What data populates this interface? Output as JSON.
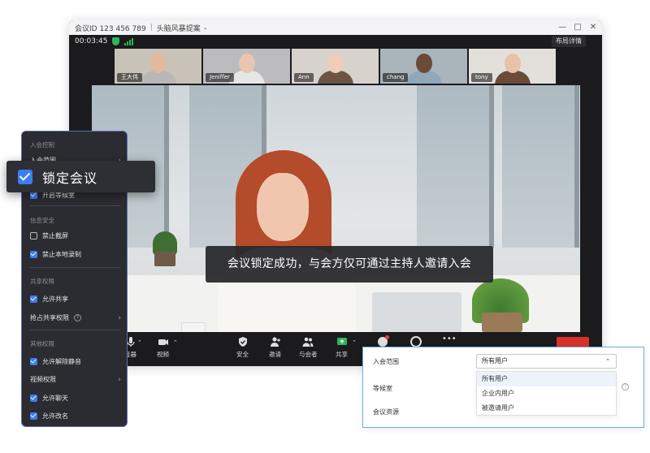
{
  "window": {
    "meeting_id": "会议ID 123 456 789",
    "meeting_topic": "头脑风暴提案",
    "timer": "00:03:45",
    "layout_button": "布局详情"
  },
  "participants": [
    {
      "name": "王大伟",
      "bg": "#c9c2b8",
      "skin": "#e2b99d",
      "clothes": "#b7b7b7"
    },
    {
      "name": "Jeniffer",
      "bg": "#bcbcbe",
      "skin": "#e9c6af",
      "clothes": "#e6e6e6"
    },
    {
      "name": "Ann",
      "bg": "#d7d2cc",
      "skin": "#f0cdb6",
      "clothes": "#6b5443"
    },
    {
      "name": "chang",
      "bg": "#a9b4bb",
      "skin": "#6b4a37",
      "clothes": "#8fa7b8"
    },
    {
      "name": "tony",
      "bg": "#e3e0dc",
      "skin": "#e8c2a4",
      "clothes": "#6b4a37"
    }
  ],
  "toast": "会议锁定成功，与会方仅可通过主持人邀请入会",
  "toolbar": {
    "audio": "音器",
    "video": "视频",
    "security": "安全",
    "invite": "邀请",
    "participants": "与会者",
    "share": "共享"
  },
  "security_panel": {
    "section_join": "入会控制",
    "join_range": "入会范围",
    "enable_waiting_room": "开启等候室",
    "section_info": "信息安全",
    "forbid_screenshot": "禁止截屏",
    "forbid_local_record": "禁止本地录制",
    "section_share": "共享权限",
    "allow_share": "允许共享",
    "preempt_share": "抢占共享权限",
    "section_other": "其他权限",
    "allow_unmute": "允许解除静音",
    "video_permission": "视频权限",
    "allow_chat": "允许聊天",
    "allow_rename": "允许改名",
    "lock_meeting": "锁定会议"
  },
  "checkbox_states": {
    "enable_waiting_room": true,
    "forbid_screenshot": false,
    "forbid_local_record": true,
    "allow_share": true,
    "allow_unmute": true,
    "allow_chat": true,
    "allow_rename": true,
    "lock_meeting": true
  },
  "settings_dialog": {
    "join_range_label": "入会范围",
    "waiting_room_label": "等候室",
    "meeting_resource_label": "会议资源",
    "selected": "所有用户",
    "options": [
      "所有用户",
      "企业内用户",
      "被邀请用户"
    ]
  },
  "colors": {
    "accent": "#3d7cf2",
    "panel_bg": "#2b2c31",
    "green": "#2fb45a",
    "dialog_border": "#6ab0e2"
  }
}
